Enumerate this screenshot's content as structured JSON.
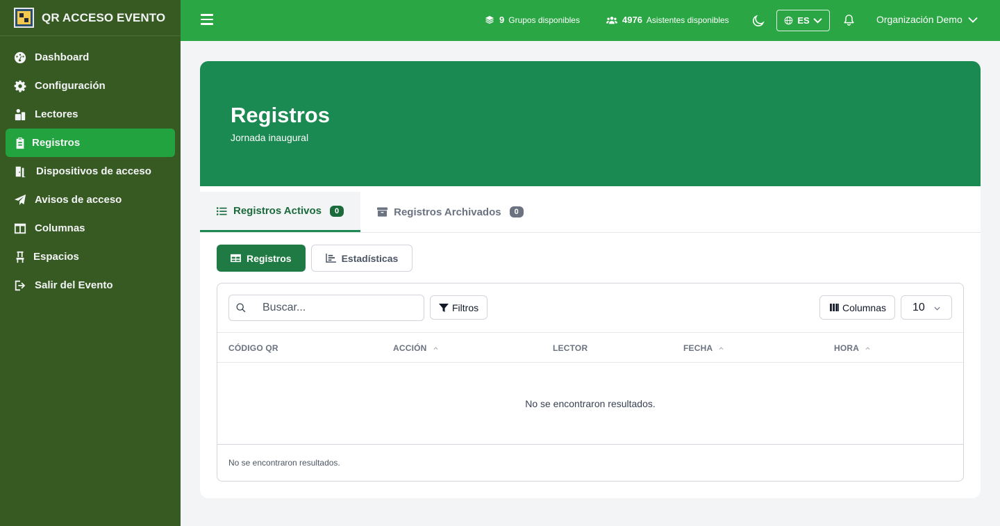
{
  "app": {
    "title": "QR ACCESO EVENTO"
  },
  "sidebar": {
    "items": [
      {
        "label": "Dashboard",
        "icon": "gauge-icon"
      },
      {
        "label": "Configuración",
        "icon": "gear-icon"
      },
      {
        "label": "Lectores",
        "icon": "readers-icon"
      },
      {
        "label": "Registros",
        "icon": "clipboard-icon",
        "active": true
      },
      {
        "label": "Dispositivos de acceso",
        "icon": "door-icon"
      },
      {
        "label": "Avisos de acceso",
        "icon": "paper-plane-icon"
      },
      {
        "label": "Columnas",
        "icon": "columns-icon"
      },
      {
        "label": "Espacios",
        "icon": "chair-icon"
      },
      {
        "label": "Salir del Evento",
        "icon": "logout-icon"
      }
    ]
  },
  "topbar": {
    "groups_count": "9",
    "groups_label": "Grupos disponibles",
    "attendees_count": "4976",
    "attendees_label": "Asistentes disponibles",
    "language": "ES",
    "organization": "Organización Demo"
  },
  "hero": {
    "title": "Registros",
    "subtitle": "Jornada inaugural"
  },
  "tabs": [
    {
      "label": "Registros Activos",
      "count": "0",
      "active": true
    },
    {
      "label": "Registros Archivados",
      "count": "0",
      "active": false
    }
  ],
  "views": {
    "records": "Registros",
    "stats": "Estadísticas"
  },
  "table": {
    "search_placeholder": "Buscar...",
    "filters_label": "Filtros",
    "columns_label": "Columnas",
    "page_size": "10",
    "headers": [
      "CÓDIGO QR",
      "ACCIÓN",
      "LECTOR",
      "FECHA",
      "HORA"
    ],
    "empty_text": "No se encontraron resultados.",
    "footer_text": "No se encontraron resultados."
  },
  "colors": {
    "sidebar": "#375a23",
    "topbar": "#2aa744",
    "hero": "#1a8a52",
    "active_nav": "#22a33f"
  }
}
